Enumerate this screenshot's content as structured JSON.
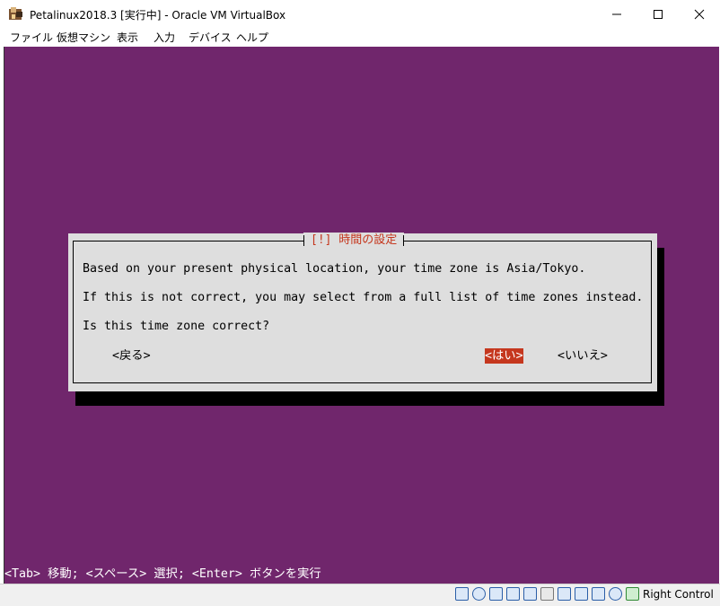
{
  "window": {
    "title": "Petalinux2018.3 [実行中] - Oracle VM VirtualBox"
  },
  "menu": [
    {
      "label": "ファイル"
    },
    {
      "label": "仮想マシン"
    },
    {
      "label": "表示"
    },
    {
      "label": "入力"
    },
    {
      "label": "デバイス"
    },
    {
      "label": "ヘルプ"
    }
  ],
  "dialog": {
    "title": "[!] 時間の設定",
    "line1": "Based on your present physical location, your time zone is Asia/Tokyo.",
    "line2": "If this is not correct, you may select from a full list of time zones instead.",
    "question": "Is this time zone correct?",
    "back_button": "<戻る>",
    "yes_button": "<はい>",
    "no_button": "<いいえ>"
  },
  "help": {
    "text": "<Tab> 移動; <スペース> 選択; <Enter> ボタンを実行"
  },
  "status": {
    "host_key": "Right Control"
  },
  "colors": {
    "desktop": "#70266c",
    "dialog_bg": "#dedede",
    "accent": "#c5371e"
  }
}
